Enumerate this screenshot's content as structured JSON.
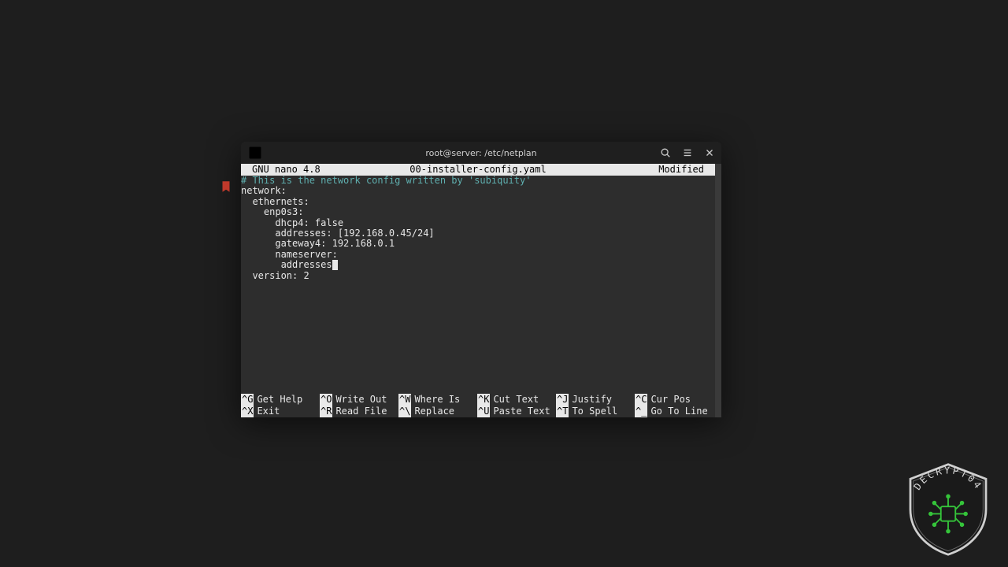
{
  "window": {
    "title": "root@server: /etc/netplan"
  },
  "nano": {
    "app": "  GNU nano 4.8",
    "filename": "00-installer-config.yaml",
    "status": "Modified "
  },
  "file": {
    "comment": "# This is the network config written by 'subiquity'",
    "l1": "network:",
    "l2": "  ethernets:",
    "l3": "    enp0s3:",
    "l4": "      dhcp4: false",
    "l5": "      addresses: [192.168.0.45/24]",
    "l6": "      gateway4: 192.168.0.1",
    "l7": "      nameserver:",
    "l8a": "       addresses",
    "l9": "  version: 2"
  },
  "footer": {
    "r1": [
      {
        "k": "^G",
        "l": "Get Help"
      },
      {
        "k": "^O",
        "l": "Write Out"
      },
      {
        "k": "^W",
        "l": "Where Is"
      },
      {
        "k": "^K",
        "l": "Cut Text"
      },
      {
        "k": "^J",
        "l": "Justify"
      },
      {
        "k": "^C",
        "l": "Cur Pos"
      }
    ],
    "r2": [
      {
        "k": "^X",
        "l": "Exit"
      },
      {
        "k": "^R",
        "l": "Read File"
      },
      {
        "k": "^\\",
        "l": "Replace"
      },
      {
        "k": "^U",
        "l": "Paste Text"
      },
      {
        "k": "^T",
        "l": "To Spell"
      },
      {
        "k": "^_",
        "l": "Go To Line"
      }
    ]
  },
  "watermark": {
    "text": "DECRYPT04"
  }
}
